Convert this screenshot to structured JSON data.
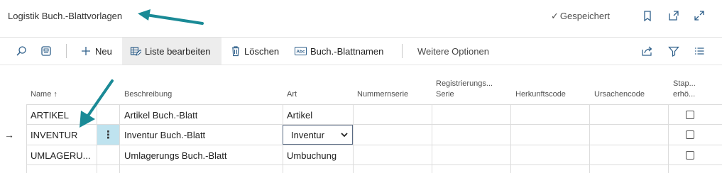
{
  "header": {
    "title": "Logistik Buch.-Blattvorlagen",
    "saved_label": "Gespeichert",
    "icons": [
      "bookmark-icon",
      "open-new-window-icon",
      "expand-icon"
    ]
  },
  "toolbar": {
    "search_icon": "search-icon",
    "view_icon": "view-layout-icon",
    "new_label": "Neu",
    "edit_list_label": "Liste bearbeiten",
    "delete_label": "Löschen",
    "journal_names_label": "Buch.-Blattnamen",
    "more_options_label": "Weitere Optionen",
    "right_icons": [
      "share-icon",
      "filter-icon",
      "list-view-icon"
    ]
  },
  "columns": {
    "name": "Name",
    "description": "Beschreibung",
    "type": "Art",
    "no_series": "Nummernserie",
    "posting_no_series_1": "Registrierungs...",
    "posting_no_series_2": "Serie",
    "source_code": "Herkunftscode",
    "reason_code": "Ursachencode",
    "increment_1": "Stap...",
    "increment_2": "erhö..."
  },
  "rows": [
    {
      "name": "ARTIKEL",
      "description": "Artikel Buch.-Blatt",
      "type": "Artikel",
      "checked": false
    },
    {
      "name": "INVENTUR",
      "description": "Inventur Buch.-Blatt",
      "type": "Inventur",
      "checked": false
    },
    {
      "name": "UMLAGERU...",
      "description": "Umlagerungs Buch.-Blatt",
      "type": "Umbuchung",
      "checked": false
    }
  ],
  "colors": {
    "accent_arrow": "#1a8a96",
    "selected_dots_bg": "#bfe3ef",
    "active_tool_bg": "#ededed"
  }
}
